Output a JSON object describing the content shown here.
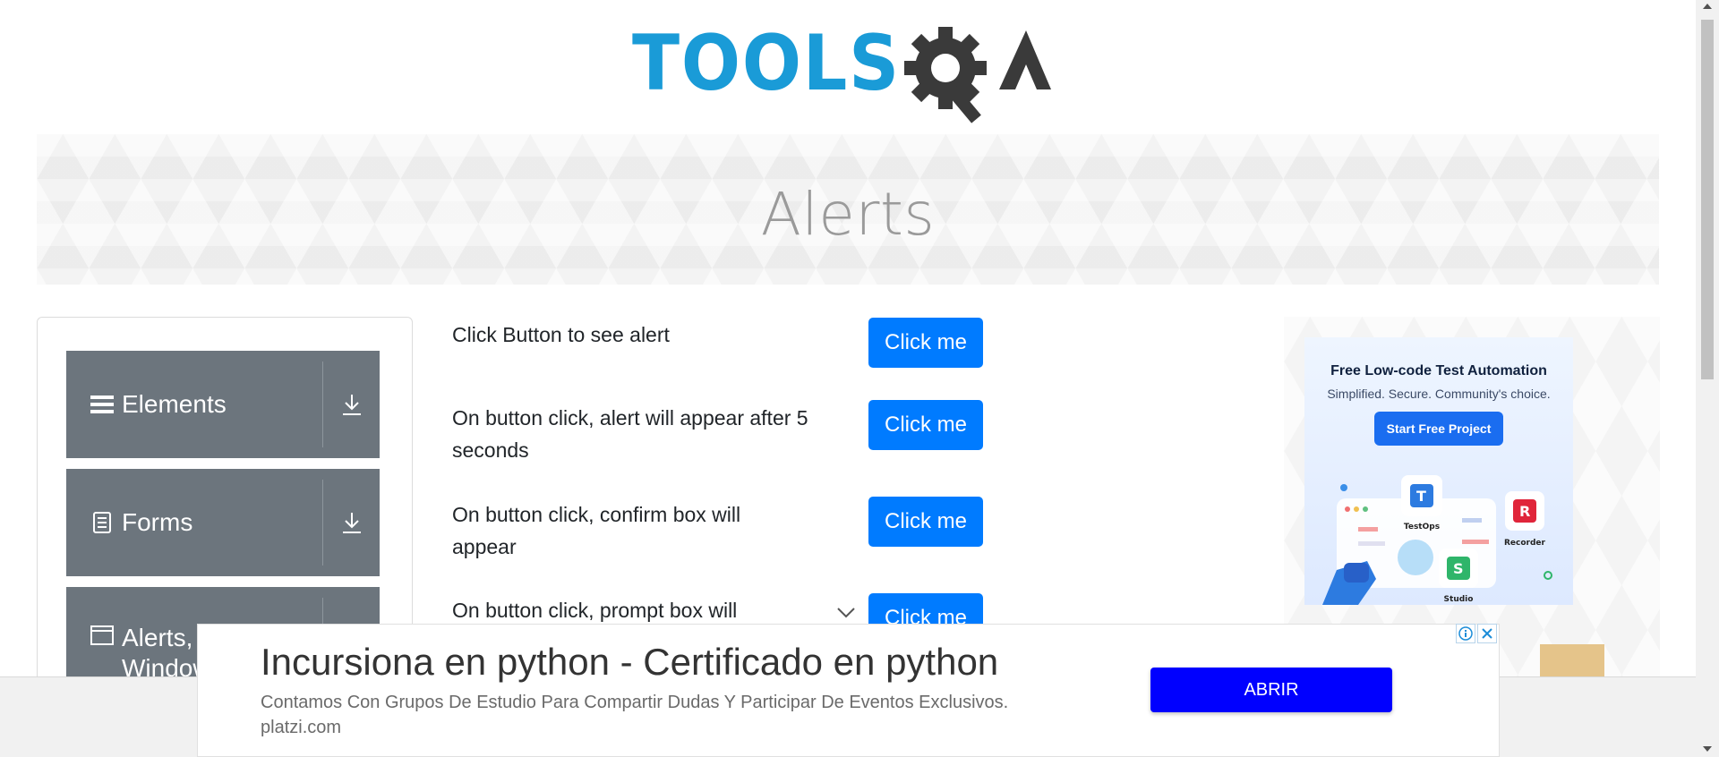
{
  "logo": {
    "text": "TOOLSQA",
    "alt": "ToolsQA"
  },
  "banner": {
    "title": "Alerts"
  },
  "sidebar": {
    "groups": [
      {
        "label": "Elements",
        "icon": "hamburger-icon"
      },
      {
        "label": "Forms",
        "icon": "document-icon"
      },
      {
        "label": "Alerts, Frame & Windows",
        "icon": "window-icon"
      }
    ]
  },
  "alerts": {
    "rows": [
      {
        "text": "Click Button to see alert",
        "button": "Click me"
      },
      {
        "text": "On button click, alert will appear after 5 seconds",
        "button": "Click me"
      },
      {
        "text": "On button click, confirm box will appear",
        "button": "Click me"
      },
      {
        "text": "On button click, prompt box will",
        "button": "Click me"
      }
    ]
  },
  "side_ad": {
    "title": "Free Low-code Test Automation",
    "subtitle": "Simplified. Secure. Community's choice.",
    "cta": "Start Free Project",
    "labels": [
      "TestOps",
      "Recorder",
      "Studio"
    ]
  },
  "bottom_ad": {
    "headline": "Incursiona en python - Certificado en python",
    "description": "Contamos Con Grupos De Estudio Para Compartir Dudas Y Participar De Eventos Exclusivos.",
    "domain": "platzi.com",
    "cta": "ABRIR"
  },
  "colors": {
    "primary": "#007bff",
    "menu_group": "#6c757d",
    "ad_cta": "#0000ff",
    "logo_blue": "#1a9bd7",
    "logo_dark": "#3a3a3a"
  }
}
